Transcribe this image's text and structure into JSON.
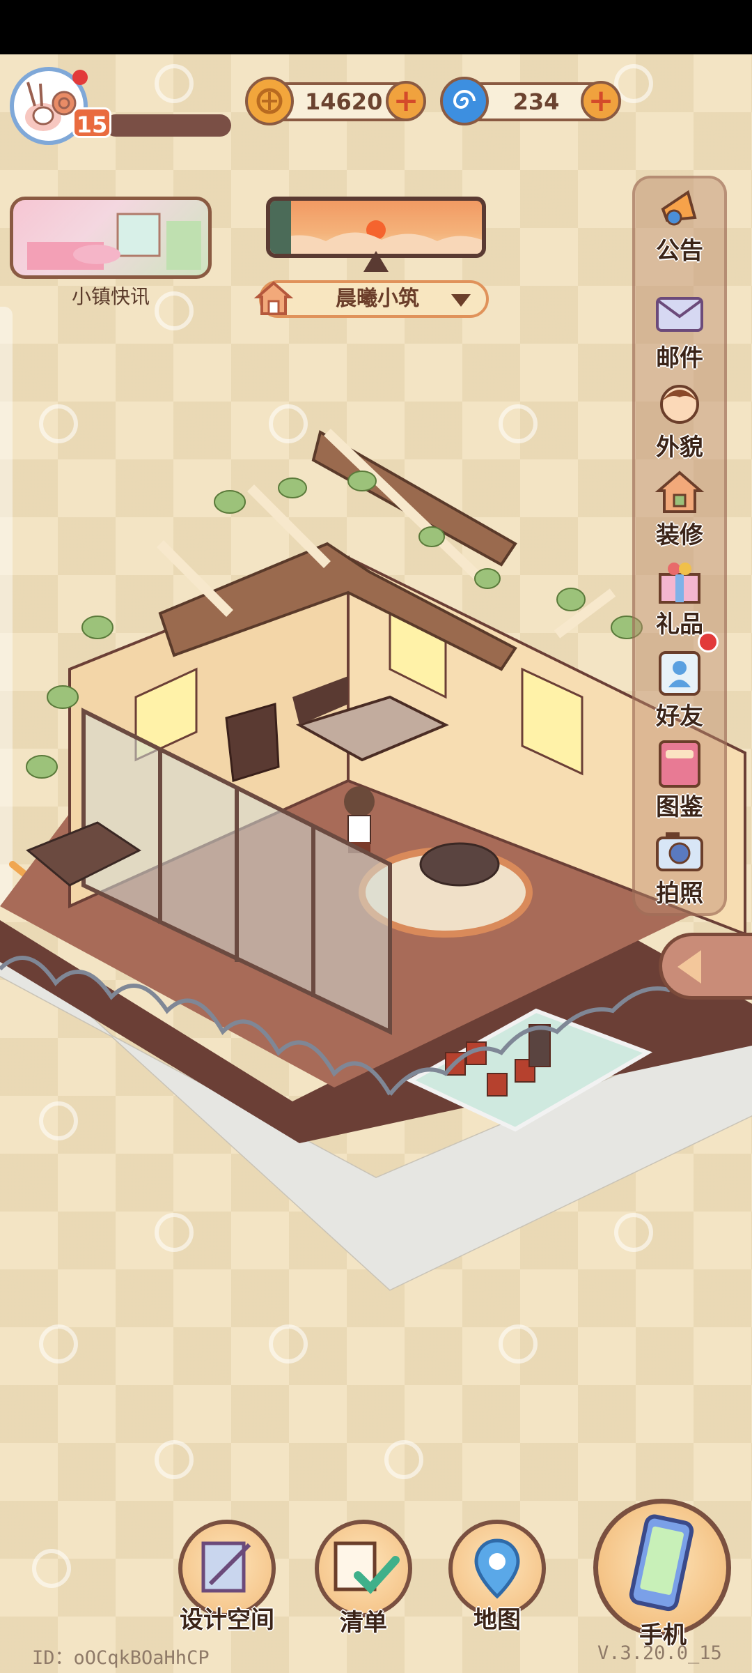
{
  "player": {
    "level": "15",
    "avatar_icon": "snail-icon"
  },
  "currencies": [
    {
      "name": "coins",
      "value": "14620",
      "icon": "coin-icon",
      "color": "#f2a63c"
    },
    {
      "name": "gems",
      "value": "234",
      "icon": "swirl-icon",
      "color": "#3d8fe0"
    }
  ],
  "news": {
    "label": "小镇快讯"
  },
  "location": {
    "name": "晨曦小筑"
  },
  "side_menu": [
    {
      "label": "公告",
      "icon": "announcement-icon"
    },
    {
      "label": "邮件",
      "icon": "mail-icon"
    },
    {
      "label": "外貌",
      "icon": "appearance-icon"
    },
    {
      "label": "装修",
      "icon": "renovate-icon"
    },
    {
      "label": "礼品",
      "icon": "gift-icon"
    },
    {
      "label": "好友",
      "icon": "friends-icon"
    },
    {
      "label": "图鉴",
      "icon": "collection-book-icon"
    },
    {
      "label": "拍照",
      "icon": "camera-icon"
    }
  ],
  "bottom_nav": [
    {
      "label": "设计空间",
      "icon": "design-space-icon"
    },
    {
      "label": "清单",
      "icon": "checklist-icon"
    },
    {
      "label": "地图",
      "icon": "map-pin-icon"
    },
    {
      "label": "手机",
      "icon": "phone-icon"
    }
  ],
  "footer": {
    "user_id": "ID：oOCqkBOaHhCP",
    "version": "V.3.20.0_15"
  }
}
